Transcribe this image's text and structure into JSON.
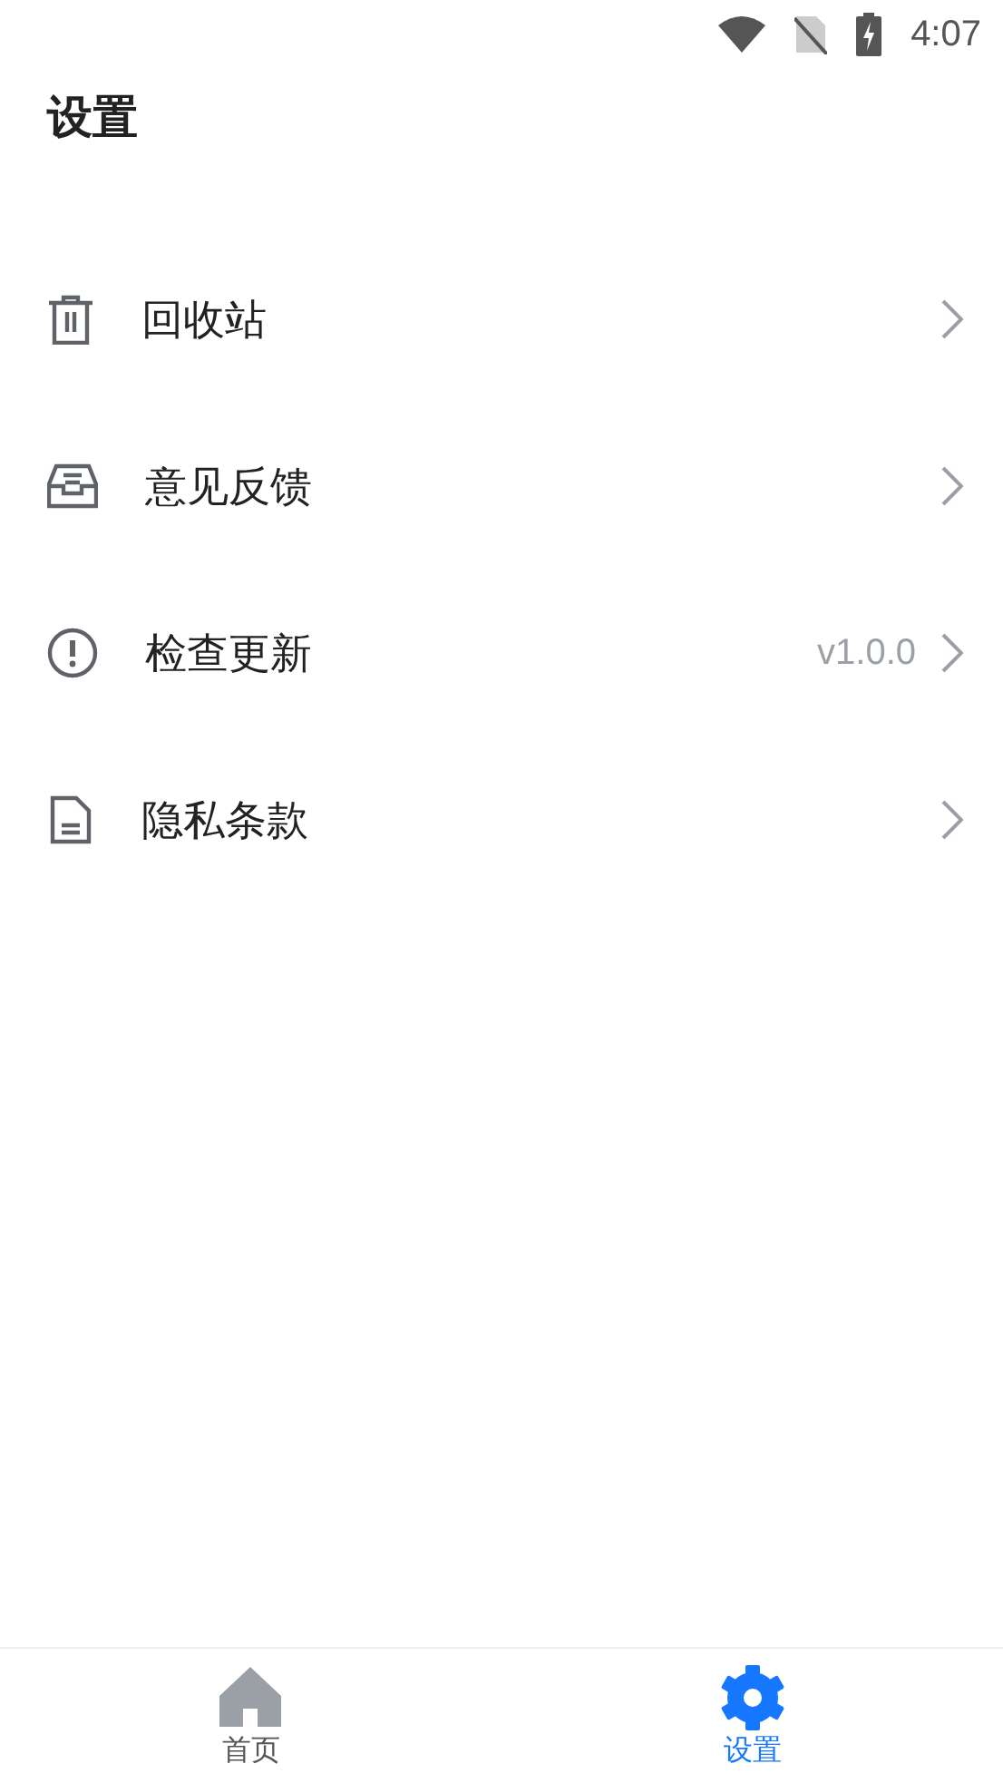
{
  "status_bar": {
    "time": "4:07"
  },
  "title": "设置",
  "items": [
    {
      "label": "回收站"
    },
    {
      "label": "意见反馈"
    },
    {
      "label": "检查更新",
      "value": "v1.0.0"
    },
    {
      "label": "隐私条款"
    }
  ],
  "tabs": [
    {
      "label": "首页",
      "selected": false
    },
    {
      "label": "设置",
      "selected": true
    }
  ]
}
